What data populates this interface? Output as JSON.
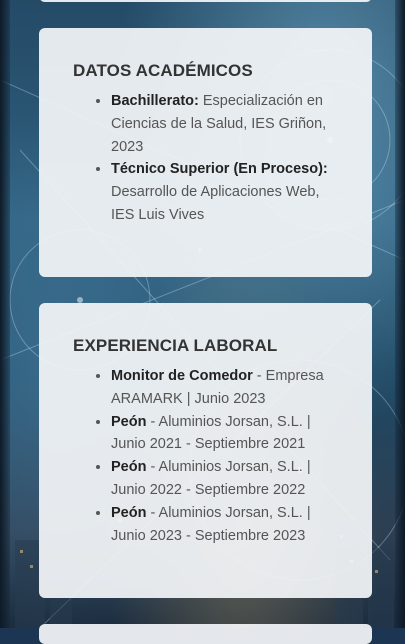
{
  "academic": {
    "title": "DATOS ACADÉMICOS",
    "items": [
      {
        "label": "Bachillerato:",
        "text": " Especialización en Ciencias de la Salud, IES Griñon, 2023"
      },
      {
        "label": "Técnico Superior (En Proceso):",
        "text": " Desarrollo de Aplicaciones Web, IES Luis Vives"
      }
    ]
  },
  "work": {
    "title": "EXPERIENCIA LABORAL",
    "items": [
      {
        "label": "Monitor de Comedor",
        "text": " - Empresa ARAMARK | Junio 2023"
      },
      {
        "label": "Peón",
        "text": " - Aluminios Jorsan, S.L. | Junio 2021 - Septiembre 2021"
      },
      {
        "label": "Peón",
        "text": " - Aluminios Jorsan, S.L. | Junio 2022 - Septiembre 2022"
      },
      {
        "label": "Peón",
        "text": " - Aluminios Jorsan, S.L. | Junio 2023 - Septiembre 2023"
      }
    ]
  },
  "colors": {
    "card_background": "#f3f5f8",
    "heading": "#333333",
    "label": "#222222",
    "body_text": "#555555"
  }
}
